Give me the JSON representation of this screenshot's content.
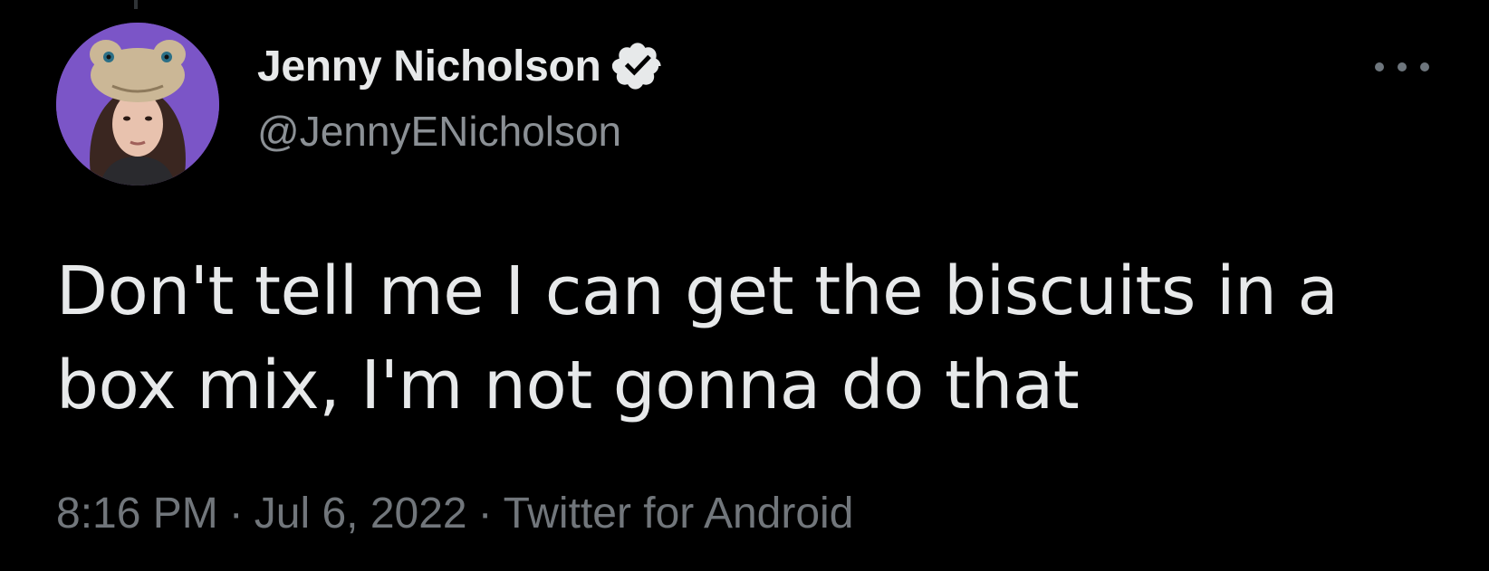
{
  "tweet": {
    "author": {
      "display_name": "Jenny Nicholson",
      "handle": "@JennyENicholson",
      "verified": true,
      "avatar_icon": "profile-photo-purple-background"
    },
    "text": "Don't tell me I can get the biscuits in a box mix, I'm not gonna do that",
    "time": "8:16 PM",
    "date": "Jul 6, 2022",
    "separator": "·",
    "source": "Twitter for Android",
    "more_icon": "more-horizontal-icon"
  },
  "colors": {
    "background": "#000000",
    "primary_text": "#e7e9ea",
    "secondary_text": "#71767b",
    "avatar_background": "#7b55c7"
  }
}
